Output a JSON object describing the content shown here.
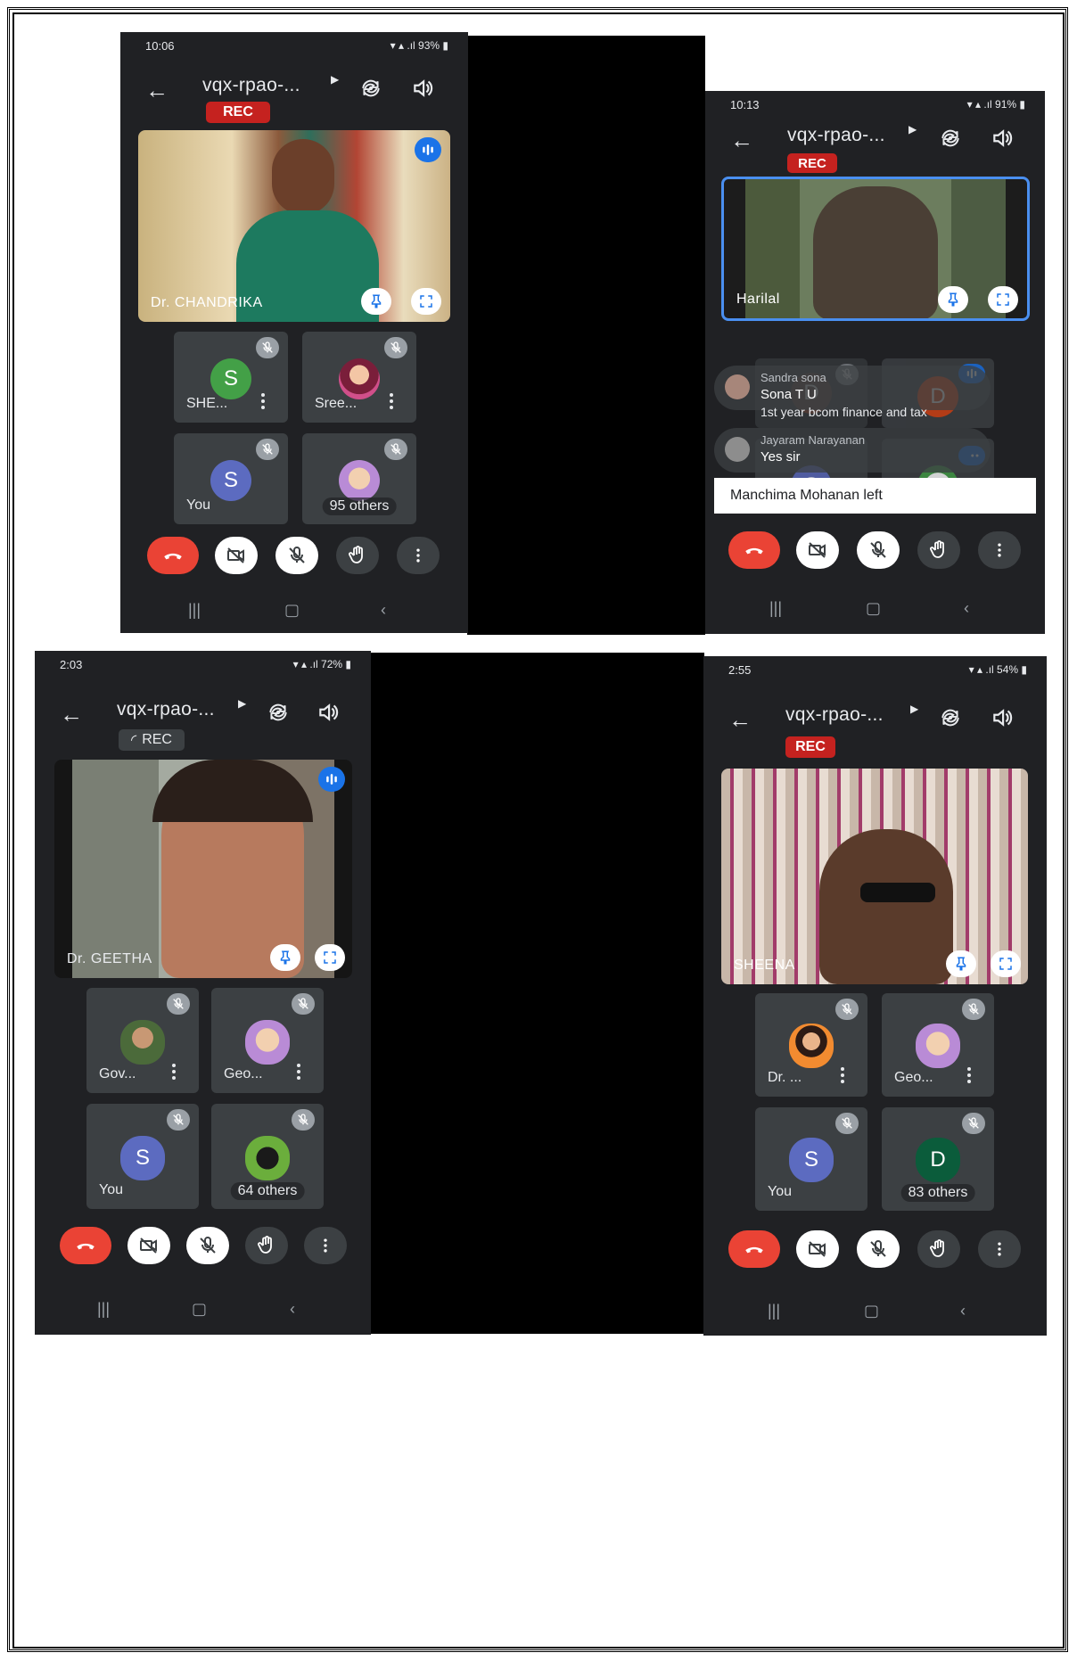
{
  "colors": {
    "end_call": "#ea4335",
    "rec": "#c5221f",
    "accent_blue": "#1a73e8",
    "tile": "#3c4043",
    "bg": "#202124"
  },
  "phones": [
    {
      "status": {
        "time": "10:06",
        "battery": "93%"
      },
      "title": "vqx-rpao-...",
      "rec": "REC",
      "main": {
        "name": "Dr. CHANDRIKA"
      },
      "tiles": [
        {
          "name": "SHE...",
          "avatar": "S"
        },
        {
          "name": "Sree..."
        },
        {
          "name": "You",
          "avatar": "S"
        },
        {
          "others": "95 others"
        }
      ]
    },
    {
      "status": {
        "time": "10:13",
        "battery": "91%"
      },
      "title": "vqx-rpao-...",
      "rec": "REC",
      "main": {
        "name": "Harilal"
      },
      "tiles": [
        {
          "avatar": "D"
        },
        {
          "avatar": "D"
        },
        {
          "avatar": "S"
        }
      ],
      "chat": [
        {
          "name": "Sandra sona",
          "msg": "Sona T U"
        },
        {
          "name": "",
          "msg": "1st year bcom finance and tax"
        },
        {
          "name": "Jayaram Narayanan",
          "msg": "Yes sir"
        }
      ],
      "toast": "Manchima Mohanan left"
    },
    {
      "status": {
        "time": "2:03",
        "battery": "72%"
      },
      "title": "vqx-rpao-...",
      "rec": "REC",
      "main": {
        "name": "Dr. GEETHA"
      },
      "tiles": [
        {
          "name": "Gov..."
        },
        {
          "name": "Geo..."
        },
        {
          "name": "You",
          "avatar": "S"
        },
        {
          "others": "64 others"
        }
      ]
    },
    {
      "status": {
        "time": "2:55",
        "battery": "54%"
      },
      "title": "vqx-rpao-...",
      "rec": "REC",
      "main": {
        "name": "SHEENA"
      },
      "tiles": [
        {
          "name": "Dr. ..."
        },
        {
          "name": "Geo..."
        },
        {
          "name": "You",
          "avatar": "S"
        },
        {
          "others": "83 others",
          "avatar": "D"
        }
      ]
    }
  ]
}
